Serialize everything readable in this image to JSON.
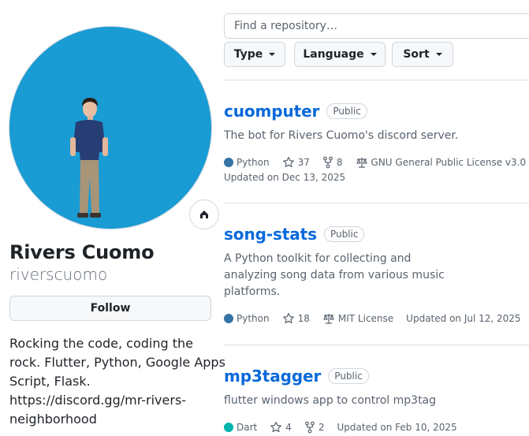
{
  "profile": {
    "name": "Rivers Cuomo",
    "login": "riverscuomo",
    "follow_label": "Follow",
    "bio_lines": [
      "Rocking the code, coding the",
      "rock. Flutter, Python, Google Apps",
      "Script, Flask.",
      "https://discord.gg/mr-rivers-",
      "neighborhood"
    ],
    "avatar_bg": "#199bd4",
    "status_icon": "status-emoji-icon"
  },
  "search": {
    "placeholder": "Find a repository…"
  },
  "filters": {
    "type_label": "Type",
    "language_label": "Language",
    "sort_label": "Sort"
  },
  "repos": [
    {
      "name": "cuomputer",
      "visibility": "Public",
      "description": [
        "The bot for Rivers Cuomo's discord server."
      ],
      "language": "Python",
      "language_color": "#3572A5",
      "stars": "37",
      "forks": "8",
      "license": "GNU General Public License v3.0",
      "updated": "Updated on Dec 13, 2025"
    },
    {
      "name": "song-stats",
      "visibility": "Public",
      "description": [
        "A Python toolkit for collecting and",
        "analyzing song data from various music",
        "platforms."
      ],
      "language": "Python",
      "language_color": "#3572A5",
      "stars": "18",
      "license": "MIT License",
      "updated": "Updated on Jul 12, 2025"
    },
    {
      "name": "mp3tagger",
      "visibility": "Public",
      "description": [
        "flutter windows app to control mp3tag"
      ],
      "language": "Dart",
      "language_color": "#00B4AB",
      "stars": "4",
      "forks": "2",
      "updated": "Updated on Feb 10, 2025"
    }
  ],
  "colors": {
    "link": "#0969da",
    "muted": "#59636e",
    "border": "#d0d7de"
  }
}
